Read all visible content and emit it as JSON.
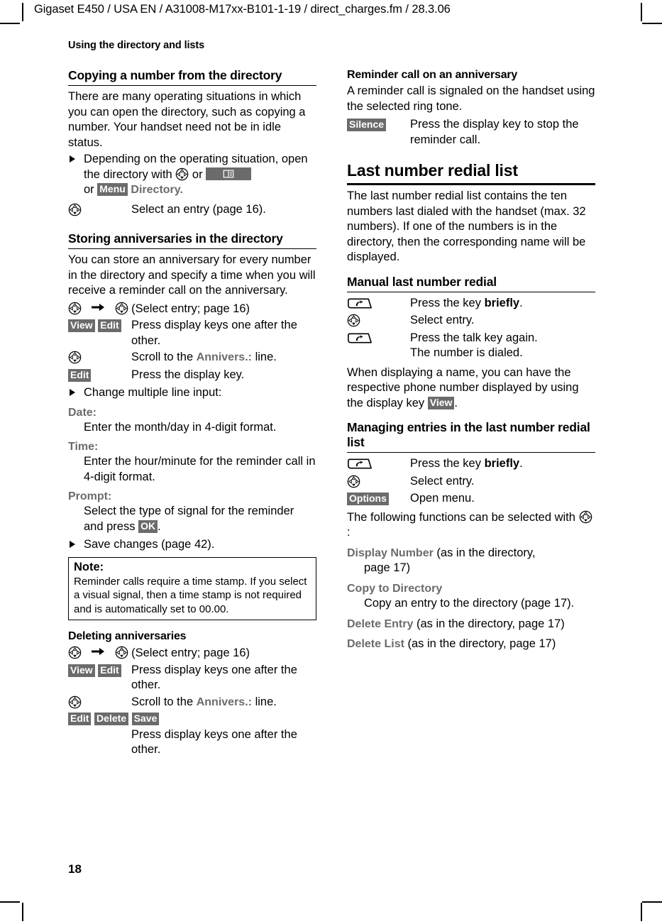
{
  "slug": "Gigaset E450 / USA EN / A31008-M17xx-B101-1-19 / direct_charges.fm / 28.3.06",
  "running_head": "Using the directory and lists",
  "page_number": "18",
  "colors": {
    "display_key_bg": "#6b6b6b",
    "ui_term": "#6b6b6b",
    "text": "#000000"
  },
  "icons": {
    "nav_key": "navigation-key-icon",
    "talk_key": "talk-key-icon",
    "directory_key": "directory-key-icon",
    "arrow": "right-arrow-icon",
    "bullet": "triangle-bullet-icon"
  },
  "left_column": {
    "section1": {
      "heading": "Copying a number from the directory",
      "intro": "There are many operating situations in which you can open the directory, such as copying a number. Your handset need not be in idle status.",
      "bullet1_a": "Depending on the operating situation, open the directory with",
      "bullet1_b": "or",
      "bullet1_c": "or",
      "bullet1_key": "Menu",
      "bullet1_d": "Directory.",
      "step1_desc": "Select an entry (page 16)."
    },
    "section2": {
      "heading": "Storing anniversaries in the directory",
      "intro": "You can store an anniversary for every number in the directory and specify a time when you will receive a reminder call on the anniversary.",
      "nav_line": "(Select entry; page 16)",
      "step_view_edit": {
        "keys": [
          "View",
          "Edit"
        ],
        "desc": "Press display keys one after the other."
      },
      "step_scroll": {
        "desc_a": "Scroll to the",
        "ui": "Annivers.:",
        "desc_b": "line."
      },
      "step_edit": {
        "key": "Edit",
        "desc": "Press the display key."
      },
      "bullet_change": "Change multiple line input:",
      "fields": [
        {
          "label": "Date:",
          "body": "Enter the month/day in 4-digit format."
        },
        {
          "label": "Time:",
          "body": "Enter the hour/minute for the reminder call in 4-digit format."
        },
        {
          "label": "Prompt:",
          "body_a": "Select the type of signal for the reminder and press",
          "key": "OK",
          "body_b": "."
        }
      ],
      "bullet_save": "Save changes (page 42).",
      "note": {
        "title": "Note:",
        "body": "Reminder calls require a time stamp. If you select a visual signal, then a time stamp is not required and is automatically set to 00.00."
      }
    },
    "section3": {
      "heading": "Deleting anniversaries",
      "nav_line": "(Select entry; page 16)",
      "step_view_edit": {
        "keys": [
          "View",
          "Edit"
        ],
        "desc": "Press display keys one after the other."
      },
      "step_scroll": {
        "desc_a": "Scroll to the",
        "ui": "Annivers.:",
        "desc_b": "line."
      },
      "step_edit_delete_save": {
        "keys": [
          "Edit",
          "Delete",
          "Save"
        ],
        "desc": "Press display keys one after the other."
      }
    }
  },
  "right_column": {
    "section1": {
      "heading": "Reminder call on an anniversary",
      "intro": "A reminder call is signaled on the handset using the selected ring tone.",
      "step_silence": {
        "key": "Silence",
        "desc": "Press the display key to stop the reminder call."
      }
    },
    "section2": {
      "heading": "Last number redial list",
      "intro": "The last number redial list contains the ten numbers last dialed with the handset (max. 32 numbers). If one of the numbers is in the directory, then the corresponding name will be displayed."
    },
    "section3": {
      "heading": "Manual last number redial",
      "step_talk1": {
        "desc_a": "Press the key",
        "strong": "briefly",
        "desc_b": "."
      },
      "step_nav": {
        "desc": "Select entry."
      },
      "step_talk2": {
        "desc": "Press the talk key again.",
        "desc2": "The number is dialed."
      },
      "outro_a": "When displaying a name, you can have the respective phone number displayed by using the display key",
      "outro_key": "View",
      "outro_b": "."
    },
    "section4": {
      "heading": "Managing entries in the last number redial list",
      "step_talk": {
        "desc_a": "Press the key",
        "strong": "briefly",
        "desc_b": "."
      },
      "step_nav": {
        "desc": "Select entry."
      },
      "step_options": {
        "key": "Options",
        "desc": "Open menu."
      },
      "functions_intro_a": "The following functions can be selected with",
      "functions_intro_b": ":",
      "functions": [
        {
          "name": "Display Number",
          "rest": "(as in the directory,",
          "sub": "page 17)"
        },
        {
          "name": "Copy to Directory",
          "rest": "",
          "sub": "Copy an entry to the directory (page 17)."
        },
        {
          "name": "Delete Entry",
          "rest": "(as in the directory, page 17)",
          "sub": ""
        },
        {
          "name": "Delete List",
          "rest": "(as in the directory, page 17)",
          "sub": ""
        }
      ]
    }
  }
}
